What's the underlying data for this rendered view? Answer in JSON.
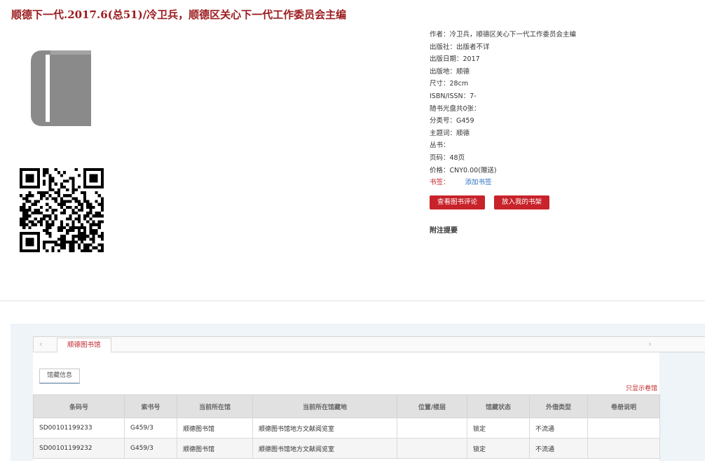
{
  "title": "顺德下一代.2017.6(总51)/冷卫兵，顺德区关心下一代工作委员会主编",
  "meta": [
    {
      "label": "作者：",
      "value": "冷卫兵，顺德区关心下一代工作委员会主编"
    },
    {
      "label": "出版社：",
      "value": "出版者不详"
    },
    {
      "label": "出版日期：",
      "value": "2017"
    },
    {
      "label": "出版地：",
      "value": "顺德"
    },
    {
      "label": "尺寸：",
      "value": "28cm"
    },
    {
      "label": "ISBN/ISSN：",
      "value": "7-"
    },
    {
      "label": "随书光盘共0张：",
      "value": ""
    },
    {
      "label": "分类号：",
      "value": "G459"
    },
    {
      "label": "主题词：",
      "value": "顺德"
    },
    {
      "label": "丛书：",
      "value": ""
    },
    {
      "label": "页码：",
      "value": "48页"
    },
    {
      "label": "价格：",
      "value": "CNY0.00(赠送)"
    }
  ],
  "bookmark": {
    "label": "书签：",
    "link": "添加书签"
  },
  "buttons": {
    "review": "查看图书评论",
    "shelf": "放入我的书架"
  },
  "notes_heading": "附注提要",
  "tabs": {
    "library": "顺德图书馆",
    "info": "馆藏信息",
    "prev_arrow": "‹",
    "next_arrow": "›"
  },
  "only_link": "只显示卷馆",
  "table": {
    "headers": [
      "条码号",
      "索书号",
      "当前所在馆",
      "当前所在馆藏地",
      "位置/楼层",
      "馆藏状态",
      "外借类型",
      "卷册说明"
    ],
    "rows": [
      [
        "SD00101199233",
        "G459/3",
        "顺德图书馆",
        "顺德图书馆地方文献阅览室",
        "",
        "锁定",
        "不流通",
        ""
      ],
      [
        "SD00101199232",
        "G459/3",
        "顺德图书馆",
        "顺德图书馆地方文献阅览室",
        "",
        "锁定",
        "不流通",
        ""
      ]
    ]
  },
  "colors": {
    "accent": "#9b1b1e",
    "button": "#c8222a",
    "link": "#2a6fc2"
  },
  "icons": {
    "book": "book-icon",
    "qr": "qr-code-icon"
  }
}
